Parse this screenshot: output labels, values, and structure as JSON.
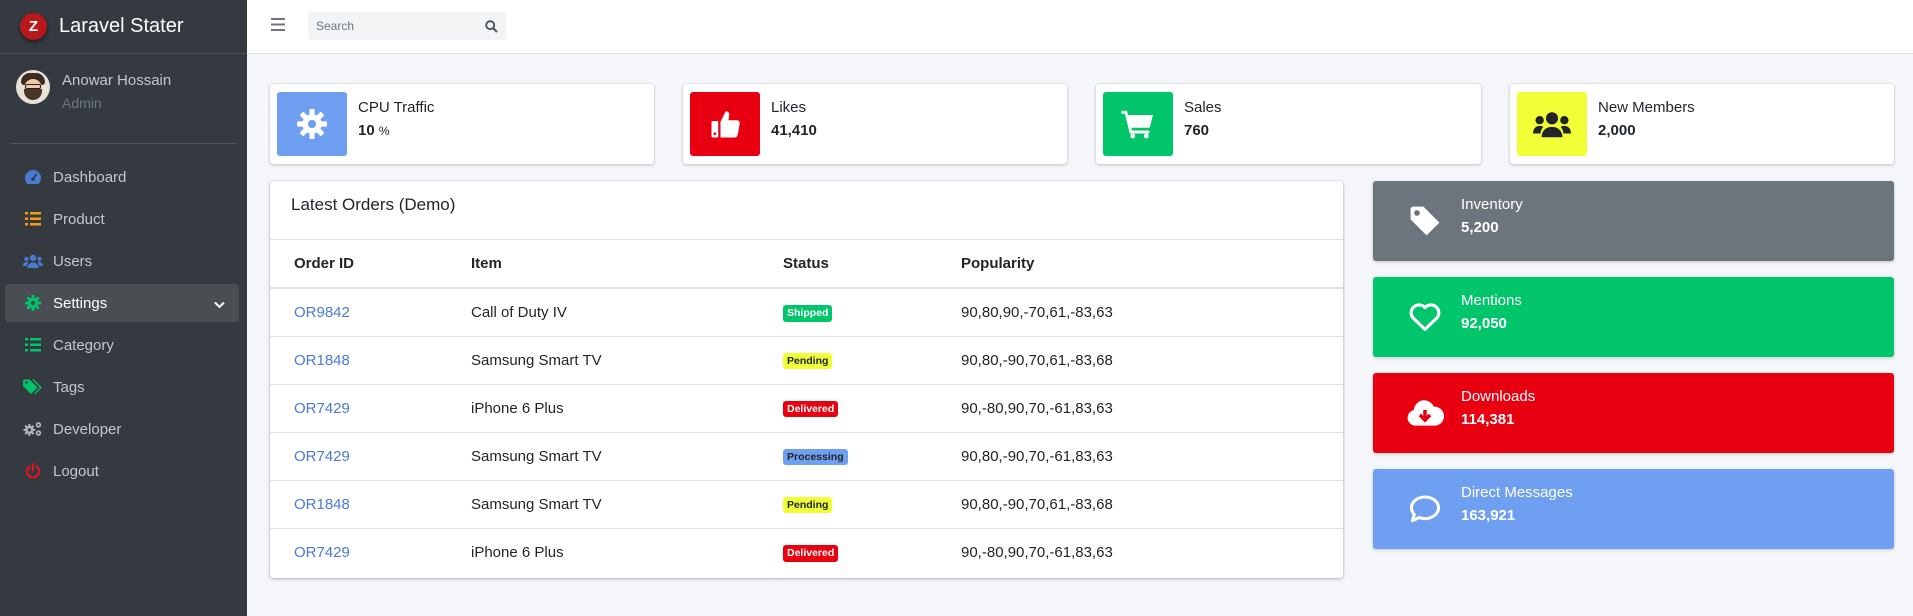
{
  "brand": {
    "logo_letter": "Z",
    "name": "Laravel Stater"
  },
  "user": {
    "name": "Anowar Hossain",
    "role": "Admin"
  },
  "nav": [
    {
      "label": "Dashboard",
      "icon": "dashboard-icon",
      "color": "#4a7bd0"
    },
    {
      "label": "Product",
      "icon": "list-icon",
      "color": "#f39c12"
    },
    {
      "label": "Users",
      "icon": "users-icon",
      "color": "#4a7bd0"
    },
    {
      "label": "Settings",
      "icon": "gear-icon",
      "color": "#00c56a",
      "active": true
    },
    {
      "label": "Category",
      "icon": "list-icon",
      "color": "#00c56a"
    },
    {
      "label": "Tags",
      "icon": "tags-icon",
      "color": "#00c56a"
    },
    {
      "label": "Developer",
      "icon": "cogs-icon",
      "color": "#adb5bd"
    },
    {
      "label": "Logout",
      "icon": "power-icon",
      "color": "#e3121b"
    }
  ],
  "search": {
    "placeholder": "Search"
  },
  "infoboxes": [
    {
      "label": "CPU Traffic",
      "value": "10",
      "unit": "%",
      "icon": "gear-icon",
      "color": "#6f9ff0"
    },
    {
      "label": "Likes",
      "value": "41,410",
      "icon": "thumbs-up-icon",
      "color": "#e90010"
    },
    {
      "label": "Sales",
      "value": "760",
      "icon": "shopping-cart-icon",
      "color": "#00c56a"
    },
    {
      "label": "New Members",
      "value": "2,000",
      "icon": "users-icon",
      "color": "#f0ff36"
    }
  ],
  "orders": {
    "title": "Latest Orders (Demo)",
    "columns": [
      "Order ID",
      "Item",
      "Status",
      "Popularity"
    ],
    "rows": [
      {
        "id": "OR9842",
        "item": "Call of Duty IV",
        "status": "Shipped",
        "status_color": "#00c56a",
        "popularity": "90,80,90,-70,61,-83,63"
      },
      {
        "id": "OR1848",
        "item": "Samsung Smart TV",
        "status": "Pending",
        "status_color": "#f0ff36",
        "popularity": "90,80,-90,70,61,-83,68"
      },
      {
        "id": "OR7429",
        "item": "iPhone 6 Plus",
        "status": "Delivered",
        "status_color": "#e90010",
        "popularity": "90,-80,90,70,-61,83,63"
      },
      {
        "id": "OR7429",
        "item": "Samsung Smart TV",
        "status": "Processing",
        "status_color": "#6f9ff0",
        "popularity": "90,80,-90,70,-61,83,63"
      },
      {
        "id": "OR1848",
        "item": "Samsung Smart TV",
        "status": "Pending",
        "status_color": "#f0ff36",
        "popularity": "90,80,-90,70,61,-83,68"
      },
      {
        "id": "OR7429",
        "item": "iPhone 6 Plus",
        "status": "Delivered",
        "status_color": "#e90010",
        "popularity": "90,-80,90,70,-61,83,63"
      }
    ]
  },
  "smallboxes": [
    {
      "label": "Inventory",
      "value": "5,200",
      "icon": "tag-icon",
      "color": "#6c757d"
    },
    {
      "label": "Mentions",
      "value": "92,050",
      "icon": "heart-icon",
      "color": "#00c56a"
    },
    {
      "label": "Downloads",
      "value": "114,381",
      "icon": "cloud-download-icon",
      "color": "#e90010"
    },
    {
      "label": "Direct Messages",
      "value": "163,921",
      "icon": "comment-icon",
      "color": "#6f9ff0"
    }
  ]
}
